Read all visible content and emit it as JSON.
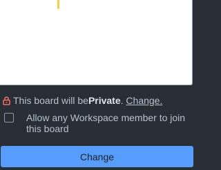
{
  "board": {
    "visibility_prefix": "This board will be ",
    "visibility_level": "Private",
    "visibility_period": ".",
    "visibility_change_link": "Change."
  },
  "workspace_join": {
    "checkbox_label": "Allow any Workspace member to join this board",
    "checked": false
  },
  "actions": {
    "change_button_label": "Change"
  },
  "colors": {
    "background": "#282e33",
    "accent_button": "#579dff",
    "lock_icon": "#f87168",
    "cursor": "#f5cd47"
  },
  "icons": {
    "visibility": "lock-icon"
  }
}
